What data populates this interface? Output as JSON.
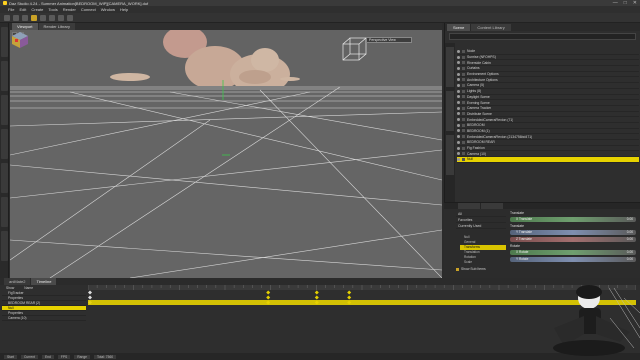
{
  "window": {
    "title": "Daz Studio 4.24 - Summer Animation[BEDROOM_WIP][CAMERA_WORK].duf",
    "controls": [
      "—",
      "□",
      "✕"
    ]
  },
  "menu": [
    "File",
    "Edit",
    "Create",
    "Tools",
    "Render",
    "Connect",
    "Window",
    "Help"
  ],
  "viewport": {
    "tabs": [
      "Viewport",
      "Render Library"
    ],
    "camera_select": "Perspective View"
  },
  "scene": {
    "tabs": [
      "Scene",
      "Content Library"
    ],
    "items": [
      "Node",
      "Sunrise (NFOHPS)",
      "Riverside Cabin",
      "Curtains",
      "Environment Options",
      "Architecture Options",
      "Camera (5)",
      "Lights (8)",
      "Daylight Scene",
      "Evening Scene",
      "Camera Tracker",
      "Distribute Scene",
      "EmbeddedCameraFlexion (71)",
      "BEDROOM",
      "BEDROOM (1)",
      "EmbeddedCameraFlexion (2134756bd471)",
      "BEDROOM REAR",
      "Fig Fashion",
      "Camera (10)",
      "Null"
    ],
    "selected": "Null"
  },
  "parameters": {
    "categories": [
      "All",
      "Favorites",
      "Currently Used"
    ],
    "tree": [
      "Null",
      "General",
      "Transforms",
      "Translation",
      "Rotation",
      "Scale"
    ],
    "tree_selected": "Transforms",
    "show_sub_items": "Show Sub Items",
    "groups": [
      {
        "header": "Translate",
        "sliders": [
          {
            "name": "X Translate",
            "value": "0.00",
            "tint": "green"
          }
        ]
      },
      {
        "header": "Translate",
        "sliders": [
          {
            "name": "Y Translate",
            "value": "0.00",
            "tint": "blue"
          },
          {
            "name": "Z Translate",
            "value": "0.00",
            "tint": "red"
          }
        ]
      },
      {
        "header": "Rotate",
        "sliders": [
          {
            "name": "X Rotate",
            "value": "0.00",
            "tint": "green"
          },
          {
            "name": "Y Rotate",
            "value": "0.00",
            "tint": "blue"
          }
        ]
      }
    ]
  },
  "timeline": {
    "tabs": [
      "aniMate2",
      "Timeline"
    ],
    "header": [
      "Show",
      "Name"
    ],
    "tracks": [
      "FigTracker",
      "Properties",
      "BEDROOM REAR (2)",
      "Null",
      "Properties",
      "Camera (10)"
    ],
    "selected_track": "Null",
    "status": [
      "Start",
      "Current",
      "End",
      "FPS",
      "Range",
      "Total: 7560"
    ],
    "keyframe_positions": [
      0,
      0.33,
      0.42,
      0.48
    ]
  },
  "colors": {
    "accent": "#e6d200",
    "viewport_bg": "#636363",
    "grid": "#d8d8d8"
  }
}
